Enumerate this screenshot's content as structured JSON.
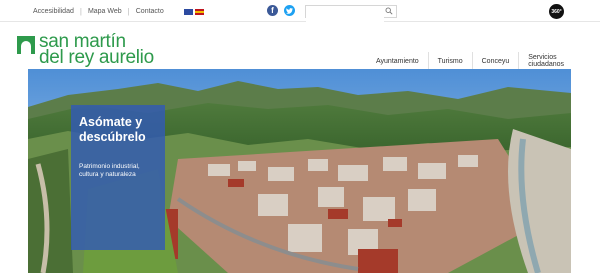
{
  "utility": {
    "items": [
      "Accesibilidad",
      "Mapa Web",
      "Contacto"
    ]
  },
  "search": {
    "placeholder": "",
    "value": ""
  },
  "badge360": "360°",
  "logo": {
    "line1": "san martín",
    "line2": "del rey aurelio"
  },
  "nav": {
    "items": [
      "Ayuntamiento",
      "Turismo",
      "Conceyu",
      "Servicios ciudadanos"
    ]
  },
  "hero": {
    "title": "Asómate y descúbrelo",
    "subtitle": "Patrimonio industrial, cultura y naturaleza",
    "slides": {
      "count": 11,
      "active": 0
    }
  },
  "colors": {
    "brand_green": "#2e9a4c",
    "caption_blue": "#325ab4",
    "facebook": "#3b5998",
    "twitter": "#1da1f2"
  },
  "icons": [
    "facebook-icon",
    "twitter-icon",
    "search-icon",
    "flag-english-icon",
    "flag-spanish-icon",
    "logo-mark-icon"
  ]
}
